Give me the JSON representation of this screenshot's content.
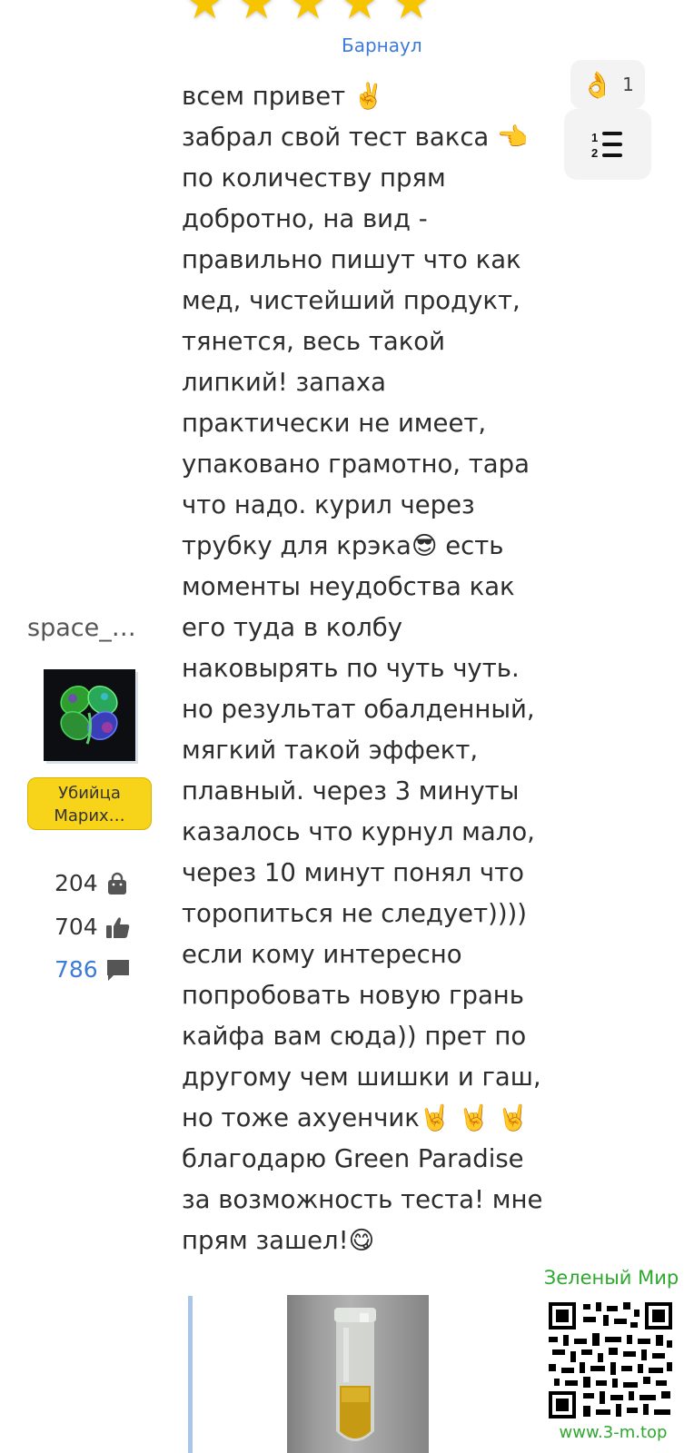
{
  "rating": {
    "stars": 5
  },
  "location": "Барнаул",
  "reaction": {
    "emoji": "👌",
    "count": "1"
  },
  "post_lines": [
    "всем привет ✌️",
    "забрал свой тест вакса 👈",
    "по количеству прям",
    "добротно, на вид -",
    "правильно пишут что как",
    "мед, чистейший продукт,",
    "тянется, весь такой",
    "липкий! запаха",
    "практически не имеет,",
    "упаковано грамотно, тара",
    "что надо. курил через",
    "трубку для крэка😎 есть",
    "моменты неудобства как",
    "его туда в колбу",
    "наковырять по чуть чуть.",
    "но результат обалденный,",
    "мягкий такой эффект,",
    "плавный. через 3 минуты",
    "казалось что курнул мало,",
    "через 10 минут понял что",
    "торопиться не следует))))",
    "если кому интересно",
    "попробовать новую грань",
    "кайфа вам сюда)) прет по",
    "другому чем шишки и гаш,",
    "но тоже ахуенчик🤘 🤘 🤘",
    "благодарю Green Paradise",
    "за возможность теста! мне",
    "прям зашел!😋"
  ],
  "author": {
    "username": "space_…",
    "rank_line1": "Убийца",
    "rank_line2": "Марих…",
    "stats": {
      "purchases": "204",
      "likes": "704",
      "comments": "786"
    }
  },
  "watermark": {
    "brand": "Зеленый Мир",
    "site": "www.3-m.top"
  },
  "colors": {
    "link": "#3d7bd6",
    "star": "#f7c400",
    "rank_badge": "#f7d31a",
    "brand_green": "#2ea82e"
  },
  "icons": [
    "star-icon",
    "ok-hand-icon",
    "numbered-list-icon",
    "shopping-bag-icon",
    "thumbs-up-icon",
    "comment-icon",
    "clover-avatar",
    "qr-code"
  ]
}
